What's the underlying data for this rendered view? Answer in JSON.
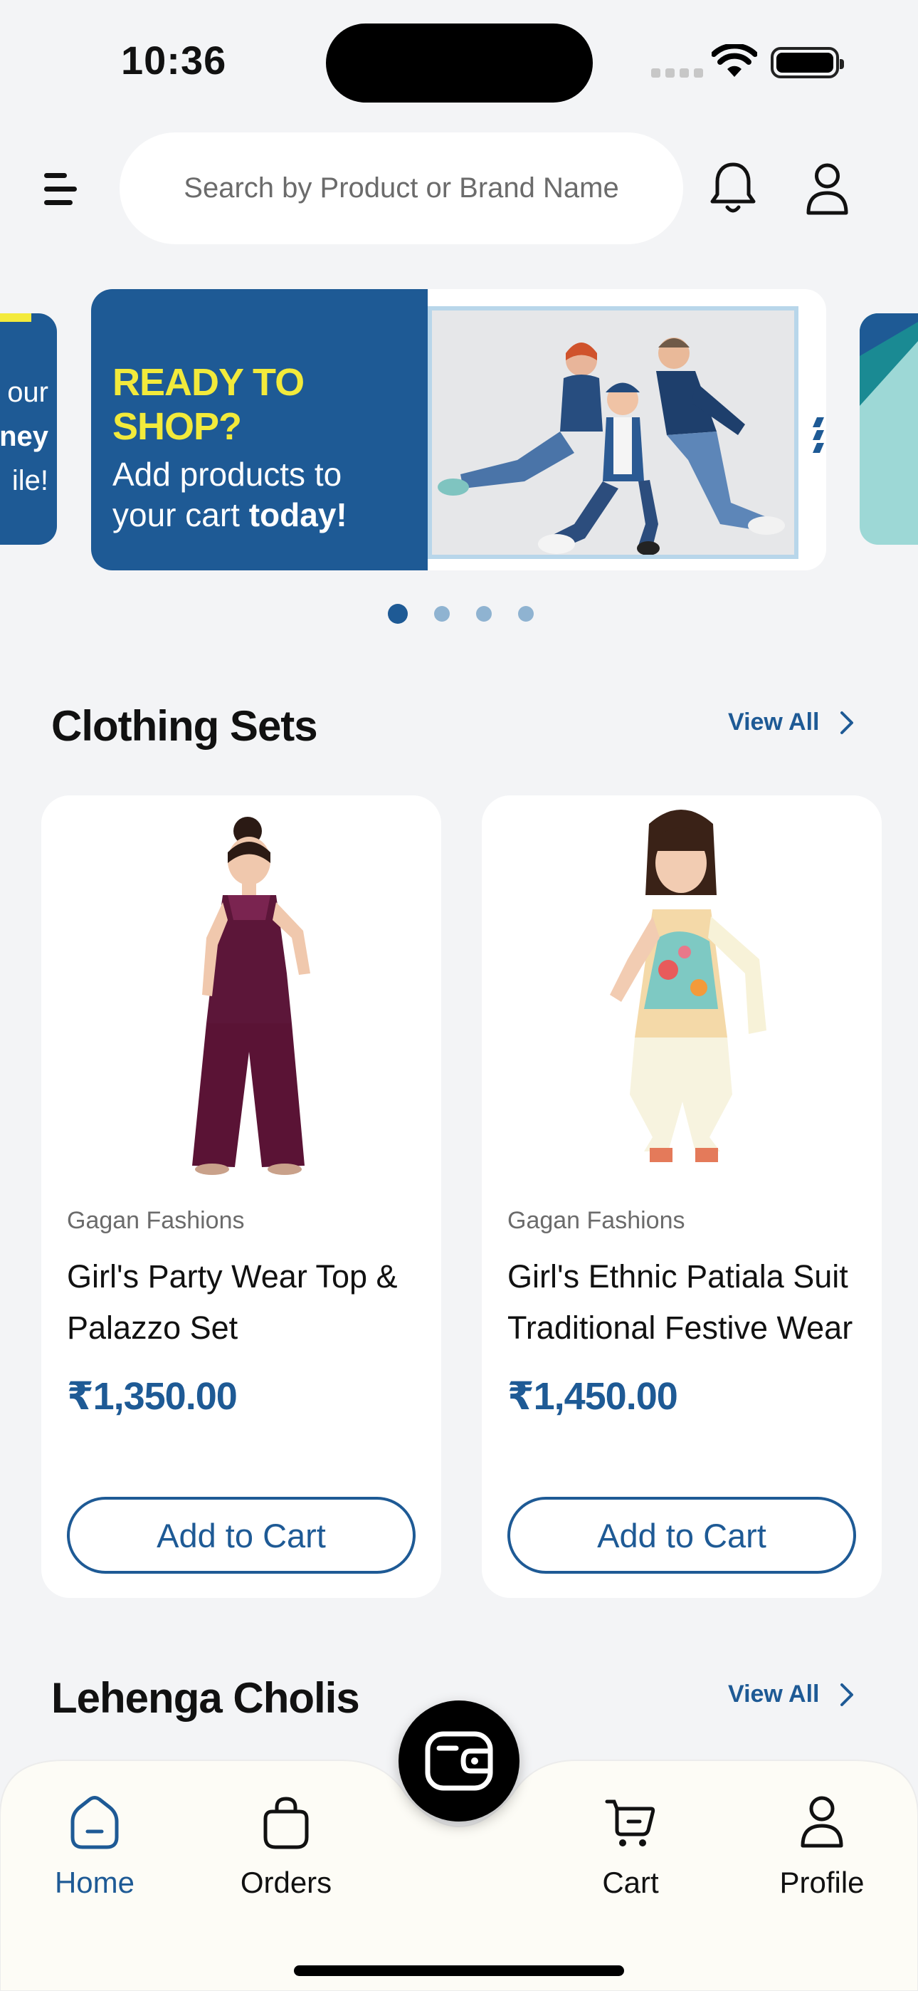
{
  "status_bar": {
    "time": "10:36"
  },
  "header": {
    "search_placeholder": "Search by Product or Brand Name"
  },
  "banner": {
    "title": "READY TO SHOP?",
    "line1": "Add products to",
    "line2_prefix": "your cart ",
    "line2_bold": "today!",
    "peek_left_lines": [
      "our",
      "ney",
      "ile!"
    ],
    "dots": 4,
    "active_dot": 1
  },
  "sections": [
    {
      "title": "Clothing Sets",
      "view_all": "View All"
    },
    {
      "title": "Lehenga Cholis",
      "view_all": "View All"
    }
  ],
  "products": [
    {
      "brand": "Gagan Fashions",
      "name": "Girl's Party Wear Top & Palazzo Set",
      "price": "₹1,350.00",
      "cta": "Add to Cart"
    },
    {
      "brand": "Gagan Fashions",
      "name": "Girl's Ethnic Patiala Suit Traditional Festive Wear",
      "price": "₹1,450.00",
      "cta": "Add to Cart"
    }
  ],
  "bottom_nav": {
    "items": [
      {
        "label": "Home",
        "icon": "home-icon",
        "active": true
      },
      {
        "label": "Orders",
        "icon": "bag-icon"
      },
      {
        "label": "Cart",
        "icon": "cart-icon"
      },
      {
        "label": "Profile",
        "icon": "profile-icon"
      }
    ],
    "center_button_icon": "wallet-icon"
  },
  "colors": {
    "primary": "#1e5a95",
    "banner_yellow": "#f2ea3b",
    "background": "#f3f4f6"
  }
}
